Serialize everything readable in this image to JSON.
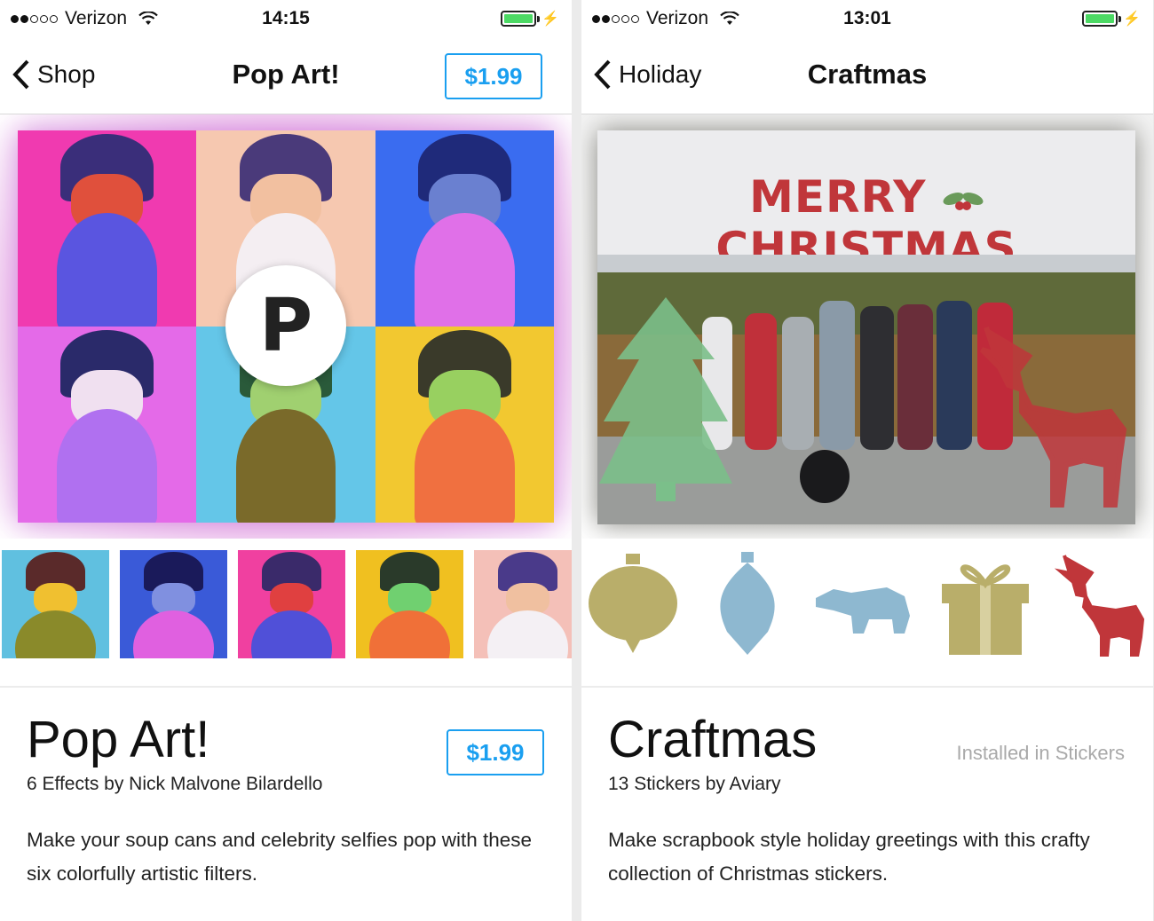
{
  "left": {
    "status": {
      "carrier": "Verizon",
      "time": "14:15"
    },
    "nav": {
      "back_label": "Shop",
      "title": "Pop Art!",
      "price": "$1.99"
    },
    "product": {
      "title": "Pop Art!",
      "subtitle": "6 Effects by Nick Malvone Bilardello",
      "description": "Make your soup cans and celebrity selfies pop with these six colorfully artistic filters.",
      "price": "$1.99"
    },
    "badge_letter": "P"
  },
  "right": {
    "status": {
      "carrier": "Verizon",
      "time": "13:01"
    },
    "nav": {
      "back_label": "Holiday",
      "title": "Craftmas"
    },
    "card_text_left": "MERRY",
    "card_text_right": "CHRISTMAS",
    "product": {
      "title": "Craftmas",
      "subtitle": "13 Stickers by Aviary",
      "description": "Make scrapbook style holiday greetings with this crafty collection of Christmas stickers.",
      "status": "Installed in Stickers"
    },
    "stickers": [
      "ornament-round",
      "ornament-drop",
      "polar-bear",
      "gift-box",
      "reindeer"
    ]
  },
  "colors": {
    "accent": "#1a9ff0",
    "battery": "#4cd964",
    "christmas_red": "#c0363a",
    "tree_green": "#7bbf8a"
  }
}
